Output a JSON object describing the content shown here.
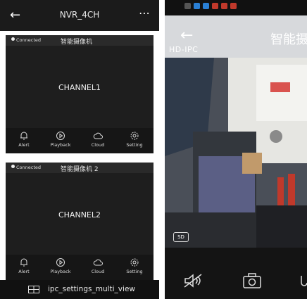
{
  "left": {
    "header": {
      "title": "NVR_4CH",
      "back_icon": "arrow-left-icon",
      "more_icon": "more-icon"
    },
    "cards": [
      {
        "status": "Connected",
        "camera_name": "智能摄像机",
        "channel": "CHANNEL1",
        "actions": [
          "Alert",
          "Playback",
          "Cloud",
          "Setting"
        ]
      },
      {
        "status": "Connected",
        "camera_name": "智能摄像机 2",
        "channel": "CHANNEL2",
        "actions": [
          "Alert",
          "Playback",
          "Cloud",
          "Setting"
        ]
      }
    ],
    "bottom": {
      "label": "ipc_settings_multi_view",
      "icon": "grid-icon"
    }
  },
  "right": {
    "overlay_label": "HD-IPC",
    "title": "智能摄",
    "quality_badge": "SD",
    "controls": [
      "mute-icon",
      "camera-icon"
    ]
  },
  "colors": {
    "bar": "#1b1b1b",
    "card": "#1e1e1e",
    "text": "#ffffff"
  }
}
